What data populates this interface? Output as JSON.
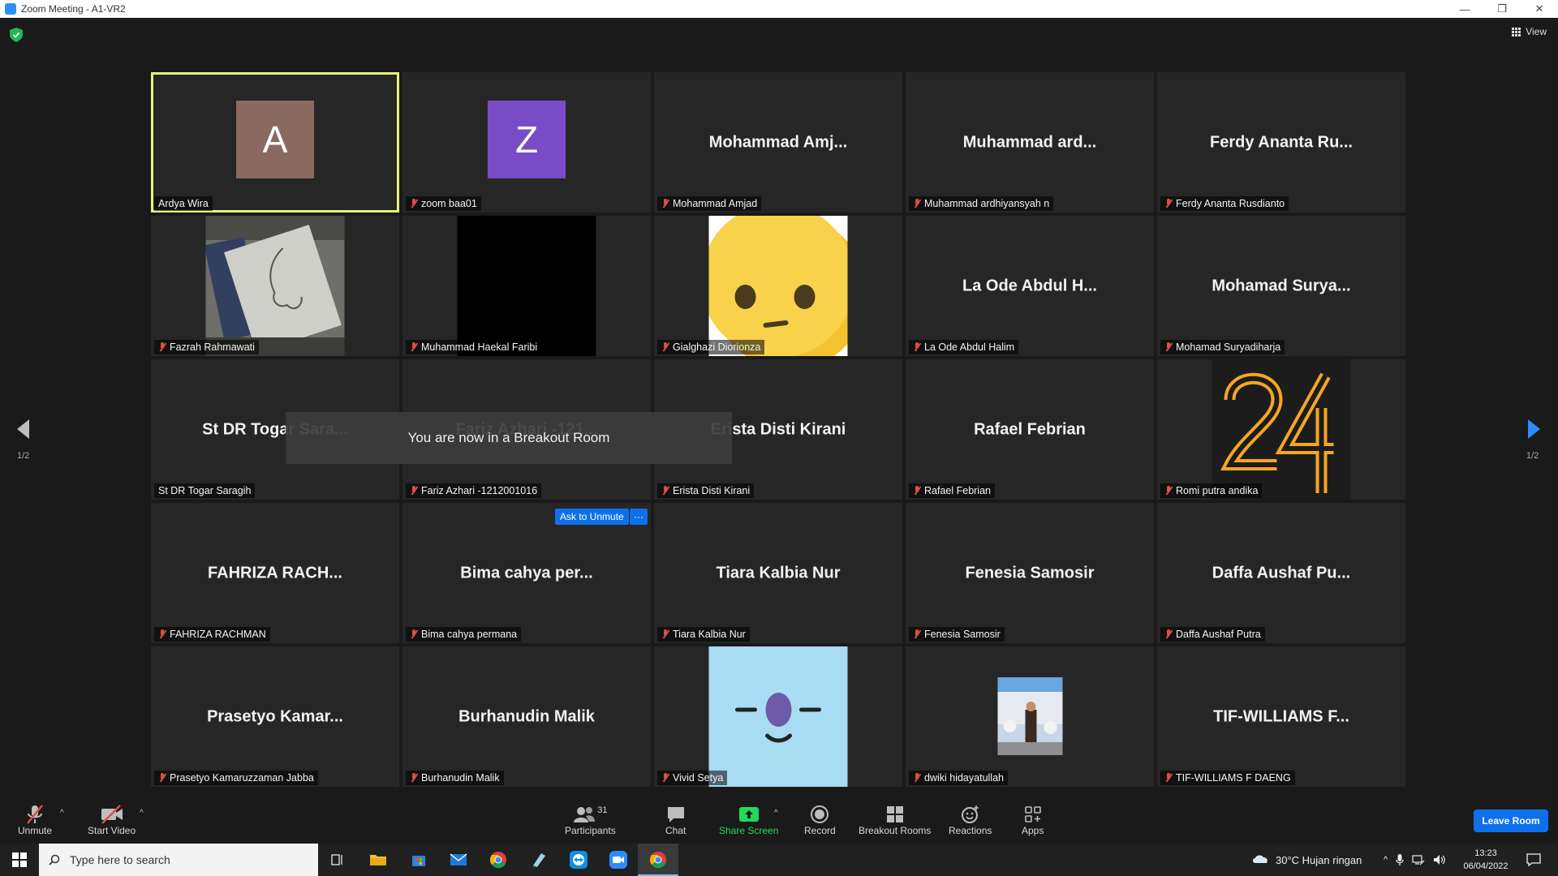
{
  "window": {
    "title": "Zoom Meeting - A1-VR2"
  },
  "topbar": {
    "view_label": "View"
  },
  "tiles": [
    {
      "display": "avatar",
      "letter": "A",
      "color": "#8a6a60",
      "nameplate": "Ardya Wira",
      "muted": false,
      "active": true
    },
    {
      "display": "avatar",
      "letter": "Z",
      "color": "#7a4bc6",
      "nameplate": "zoom baa01",
      "muted": true
    },
    {
      "display": "text",
      "big_name": "Mohammad  Amj...",
      "nameplate": "Mohammad Amjad",
      "muted": true
    },
    {
      "display": "text",
      "big_name": "Muhammad  ard...",
      "nameplate": "Muhammad ardhiyansyah n",
      "muted": true
    },
    {
      "display": "text",
      "big_name": "Ferdy  Ananta  Ru...",
      "nameplate": "Ferdy Ananta Rusdianto",
      "muted": true
    },
    {
      "display": "photo",
      "photo": "sketch",
      "nameplate": "Fazrah Rahmawati",
      "muted": true
    },
    {
      "display": "photo",
      "photo": "black",
      "nameplate": "Muhammad Haekal Faribi",
      "muted": true
    },
    {
      "display": "photo",
      "photo": "emoji-face",
      "nameplate": "Gialghazi Diorionza",
      "muted": true
    },
    {
      "display": "text",
      "big_name": "La Ode Abdul H...",
      "nameplate": "La Ode Abdul Halim",
      "muted": true
    },
    {
      "display": "text",
      "big_name": "Mohamad  Surya...",
      "nameplate": "Mohamad Suryadiharja",
      "muted": true
    },
    {
      "display": "text",
      "big_name": "St DR Togar Sara...",
      "nameplate": "St DR Togar Saragih",
      "muted": false
    },
    {
      "display": "text",
      "big_name": "Fariz Azhari -121...",
      "nameplate": "Fariz Azhari -1212001016",
      "muted": true
    },
    {
      "display": "text",
      "big_name": "Erista Disti Kirani",
      "nameplate": "Erista Disti Kirani",
      "muted": true
    },
    {
      "display": "text",
      "big_name": "Rafael Febrian",
      "nameplate": "Rafael Febrian",
      "muted": true
    },
    {
      "display": "photo",
      "photo": "number-24",
      "nameplate": "Romi putra andika",
      "muted": true
    },
    {
      "display": "text",
      "big_name": "FAHRIZA  RACH...",
      "nameplate": "FAHRIZA RACHMAN",
      "muted": true
    },
    {
      "display": "text",
      "big_name": "Bima cahya per...",
      "nameplate": "Bima cahya permana",
      "muted": true
    },
    {
      "display": "text",
      "big_name": "Tiara Kalbia Nur",
      "nameplate": "Tiara Kalbia Nur",
      "muted": true
    },
    {
      "display": "text",
      "big_name": "Fenesia Samosir",
      "nameplate": "Fenesia Samosir",
      "muted": true
    },
    {
      "display": "text",
      "big_name": "Daffa  Aushaf  Pu...",
      "nameplate": "Daffa Aushaf Putra",
      "muted": true
    },
    {
      "display": "text",
      "big_name": "Prasetyo  Kamar...",
      "nameplate": "Prasetyo Kamaruzzaman Jabba",
      "muted": true
    },
    {
      "display": "text",
      "big_name": "Burhanudin Malik",
      "nameplate": "Burhanudin Malik",
      "muted": true
    },
    {
      "display": "photo",
      "photo": "blue-face",
      "nameplate": "Vivid Setya",
      "muted": true
    },
    {
      "display": "photo",
      "photo": "wedding",
      "nameplate": "dwiki hidayatullah",
      "muted": true
    },
    {
      "display": "text",
      "big_name": "TIF-WILLIAMS  F...",
      "nameplate": "TIF-WILLIAMS F DAENG",
      "muted": true
    }
  ],
  "toast": {
    "message": "You are now in a Breakout Room"
  },
  "hover_actions": {
    "ask_unmute": "Ask to Unmute",
    "more": "···"
  },
  "pagination": {
    "left": "1/2",
    "right": "1/2"
  },
  "toolbar": {
    "unmute": "Unmute",
    "start_video": "Start Video",
    "participants": "Participants",
    "participants_count": "31",
    "chat": "Chat",
    "share_screen": "Share Screen",
    "record": "Record",
    "breakout_rooms": "Breakout Rooms",
    "reactions": "Reactions",
    "apps": "Apps",
    "leave": "Leave Room"
  },
  "taskbar": {
    "search_placeholder": "Type here to search",
    "weather": "30°C  Hujan ringan",
    "time": "13:23",
    "date": "06/04/2022"
  },
  "colors": {
    "accent": "#0e71eb",
    "active_border": "#e7f27a",
    "share_green": "#23d959",
    "muted_red": "#e04b4b"
  }
}
